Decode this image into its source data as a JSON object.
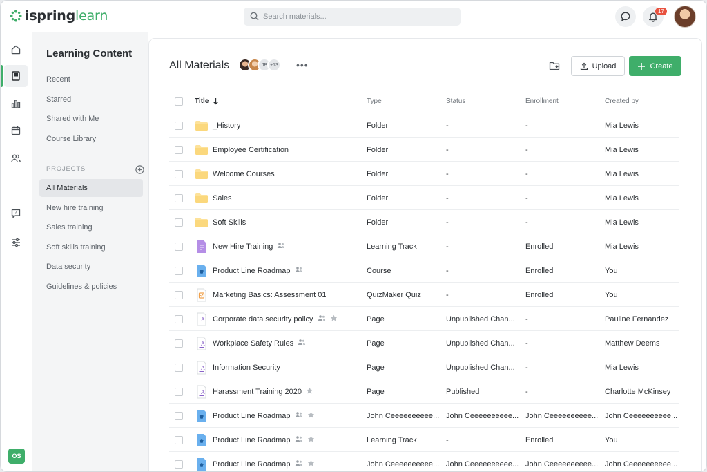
{
  "brand": {
    "name_part1": "ispring",
    "name_part2": "learn",
    "accent": "#3fae6a"
  },
  "search": {
    "placeholder": "Search materials..."
  },
  "notifications": {
    "count": "17"
  },
  "rail": {
    "user_initials": "OS"
  },
  "sidebar": {
    "title": "Learning Content",
    "links": [
      "Recent",
      "Starred",
      "Shared with Me",
      "Course Library"
    ],
    "projects_label": "PROJECTS",
    "projects": [
      "All Materials",
      "New hire training",
      "Sales training",
      "Soft skills training",
      "Data security",
      "Guidelines & policies"
    ],
    "active_project": "All Materials"
  },
  "main": {
    "title": "All Materials",
    "collaborators": {
      "initials": "JB",
      "more": "+13"
    },
    "upload_label": "Upload",
    "create_label": "Create"
  },
  "table": {
    "headers": {
      "title": "Title",
      "type": "Type",
      "status": "Status",
      "enrollment": "Enrollment",
      "created_by": "Created by"
    },
    "rows": [
      {
        "title": "_History",
        "icon": "folder-icon",
        "type": "Folder",
        "status": "-",
        "enrollment": "-",
        "created_by": "Mia Lewis",
        "shared": false,
        "starred": false
      },
      {
        "title": "Employee Certification",
        "icon": "folder-icon",
        "type": "Folder",
        "status": "-",
        "enrollment": "-",
        "created_by": "Mia Lewis",
        "shared": false,
        "starred": false
      },
      {
        "title": "Welcome Courses",
        "icon": "folder-icon",
        "type": "Folder",
        "status": "-",
        "enrollment": "-",
        "created_by": "Mia Lewis",
        "shared": false,
        "starred": false
      },
      {
        "title": "Sales",
        "icon": "folder-icon",
        "type": "Folder",
        "status": "-",
        "enrollment": "-",
        "created_by": "Mia Lewis",
        "shared": false,
        "starred": false
      },
      {
        "title": "Soft Skills",
        "icon": "folder-icon",
        "type": "Folder",
        "status": "-",
        "enrollment": "-",
        "created_by": "Mia Lewis",
        "shared": false,
        "starred": false
      },
      {
        "title": "New Hire Training",
        "icon": "learning-track-icon",
        "type": "Learning Track",
        "status": "-",
        "enrollment": "Enrolled",
        "created_by": "Mia Lewis",
        "shared": true,
        "starred": false
      },
      {
        "title": "Product Line Roadmap",
        "icon": "course-icon",
        "type": "Course",
        "status": "-",
        "enrollment": "Enrolled",
        "created_by": "You",
        "shared": true,
        "starred": false
      },
      {
        "title": "Marketing Basics: Assessment 01",
        "icon": "quiz-icon",
        "type": "QuizMaker Quiz",
        "status": "-",
        "enrollment": "Enrolled",
        "created_by": "You",
        "shared": false,
        "starred": false
      },
      {
        "title": "Corporate data security policy",
        "icon": "page-icon",
        "type": "Page",
        "status": "Unpublished Chan...",
        "enrollment": "-",
        "created_by": "Pauline Fernandez",
        "shared": true,
        "starred": true
      },
      {
        "title": "Workplace Safety Rules",
        "icon": "page-icon",
        "type": "Page",
        "status": "Unpublished Chan...",
        "enrollment": "-",
        "created_by": "Matthew Deems",
        "shared": true,
        "starred": false
      },
      {
        "title": "Information Security",
        "icon": "page-icon",
        "type": "Page",
        "status": "Unpublished Chan...",
        "enrollment": "-",
        "created_by": "Mia Lewis",
        "shared": false,
        "starred": false
      },
      {
        "title": "Harassment Training 2020",
        "icon": "page-icon",
        "type": "Page",
        "status": "Published",
        "enrollment": "-",
        "created_by": "Charlotte McKinsey",
        "shared": false,
        "starred": true
      },
      {
        "title": "Product Line Roadmap",
        "icon": "course-icon",
        "type": "John Ceeeeeeeeee...",
        "status": "John Ceeeeeeeeee...",
        "enrollment": "John Ceeeeeeeeee...",
        "created_by": "John Ceeeeeeeeee...",
        "shared": true,
        "starred": true
      },
      {
        "title": "Product Line Roadmap",
        "icon": "course-icon",
        "type": "Learning Track",
        "status": "-",
        "enrollment": "Enrolled",
        "created_by": "You",
        "shared": true,
        "starred": true
      },
      {
        "title": "Product Line Roadmap",
        "icon": "course-icon",
        "type": "John Ceeeeeeeeee...",
        "status": "John Ceeeeeeeeee...",
        "enrollment": "John Ceeeeeeeeee...",
        "created_by": "John Ceeeeeeeeee...",
        "shared": true,
        "starred": true
      }
    ]
  }
}
